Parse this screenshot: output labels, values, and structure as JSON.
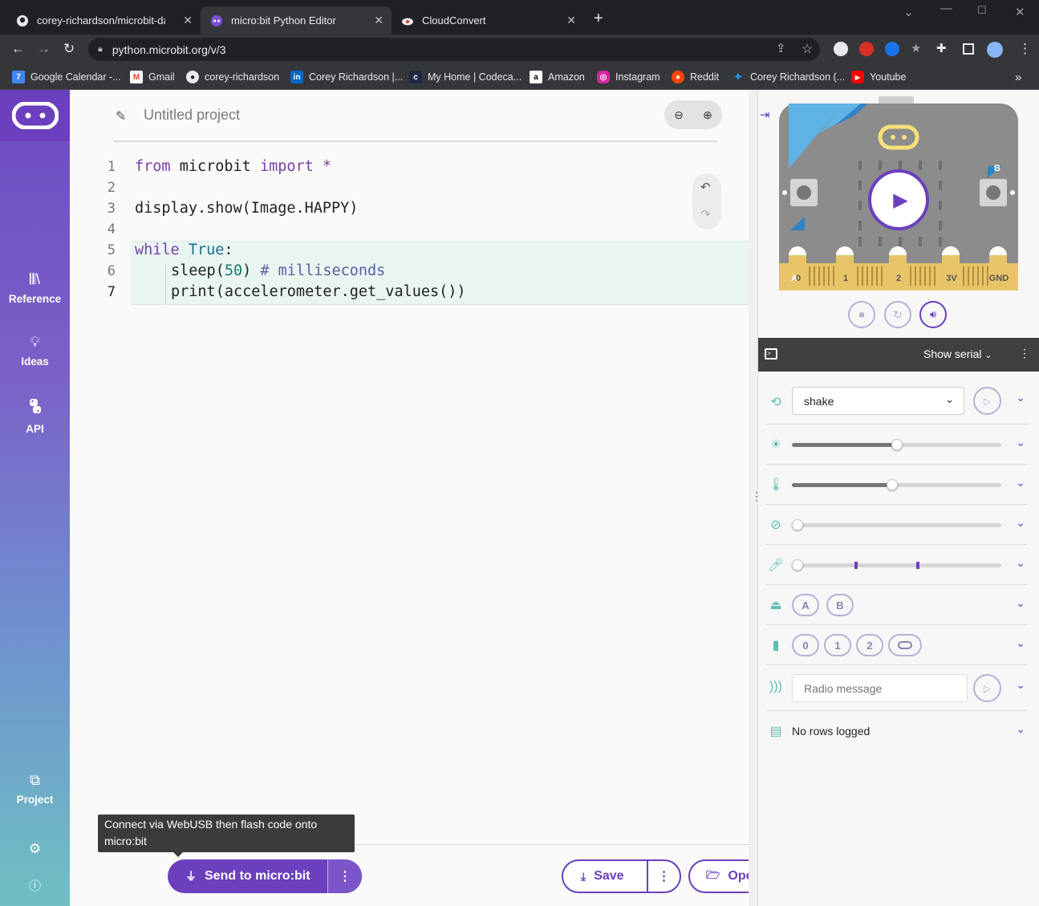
{
  "browser": {
    "tabs": [
      {
        "title": "corey-richardson/microbit-data-l",
        "icon": "github-icon"
      },
      {
        "title": "micro:bit Python Editor",
        "icon": "microbit-icon"
      },
      {
        "title": "CloudConvert",
        "icon": "cloudconvert-icon"
      }
    ],
    "url": "python.microbit.org/v/3",
    "bookmarks": [
      {
        "label": "Google Calendar -...",
        "icon": "calendar-icon",
        "color": "#4285f4",
        "glyph": "7"
      },
      {
        "label": "Gmail",
        "icon": "gmail-icon",
        "color": "#ea4335",
        "glyph": "M"
      },
      {
        "label": "corey-richardson",
        "icon": "github-icon",
        "color": "#202124",
        "glyph": "●"
      },
      {
        "label": "Corey Richardson |...",
        "icon": "linkedin-icon",
        "color": "#0a66c2",
        "glyph": "in"
      },
      {
        "label": "My Home | Codeca...",
        "icon": "codecademy-icon",
        "color": "#1f2a44",
        "glyph": "c"
      },
      {
        "label": "Amazon",
        "icon": "amazon-icon",
        "color": "#ffffff",
        "glyph": "a"
      },
      {
        "label": "Instagram",
        "icon": "instagram-icon",
        "color": "#d6249f",
        "glyph": "◎"
      },
      {
        "label": "Reddit",
        "icon": "reddit-icon",
        "color": "#ff4500",
        "glyph": "●"
      },
      {
        "label": "Corey Richardson (...",
        "icon": "twitter-icon",
        "color": "#1d9bf0",
        "glyph": "✦"
      },
      {
        "label": "Youtube",
        "icon": "youtube-icon",
        "color": "#ff0000",
        "glyph": "▶"
      }
    ]
  },
  "sidebar": {
    "items": [
      {
        "label": "Reference",
        "icon": "reference-icon"
      },
      {
        "label": "Ideas",
        "icon": "lightbulb-icon"
      },
      {
        "label": "API",
        "icon": "python-icon"
      },
      {
        "label": "Project",
        "icon": "project-files-icon"
      }
    ]
  },
  "editor": {
    "project_name": "Untitled project",
    "line_numbers": [
      "1",
      "2",
      "3",
      "4",
      "5",
      "6",
      "7"
    ],
    "code": {
      "l1_kw1": "from",
      "l1_mod": " microbit ",
      "l1_kw2": "import",
      "l1_star": " *",
      "l3": "display.show(Image.HAPPY)",
      "l5_kw": "while",
      "l5_bool": " True",
      "l5_colon": ":",
      "l6_a": "sleep(",
      "l6_num": "50",
      "l6_b": ") ",
      "l6_com": "# milliseconds",
      "l7": "print(accelerometer.get_values())"
    }
  },
  "actions": {
    "tooltip": "Connect via WebUSB then flash code onto micro:bit",
    "send_label": "Send to micro:bit",
    "save_label": "Save",
    "open_label": "Open..."
  },
  "simulator": {
    "pins": [
      "0",
      "1",
      "2",
      "3V",
      "GND"
    ],
    "button_a": "A",
    "button_b": "B",
    "serial_label": "Show serial",
    "gesture_value": "shake",
    "light_level": 0.5,
    "temperature_level": 0.48,
    "compass_level": 0,
    "sound_level": 0,
    "button_pills": [
      "A",
      "B"
    ],
    "touch_pills": [
      "0",
      "1",
      "2"
    ],
    "radio_placeholder": "Radio message",
    "log_status": "No rows logged"
  },
  "colors": {
    "brand_purple": "#6b3fbe",
    "sim_teal": "#5bbfae"
  }
}
